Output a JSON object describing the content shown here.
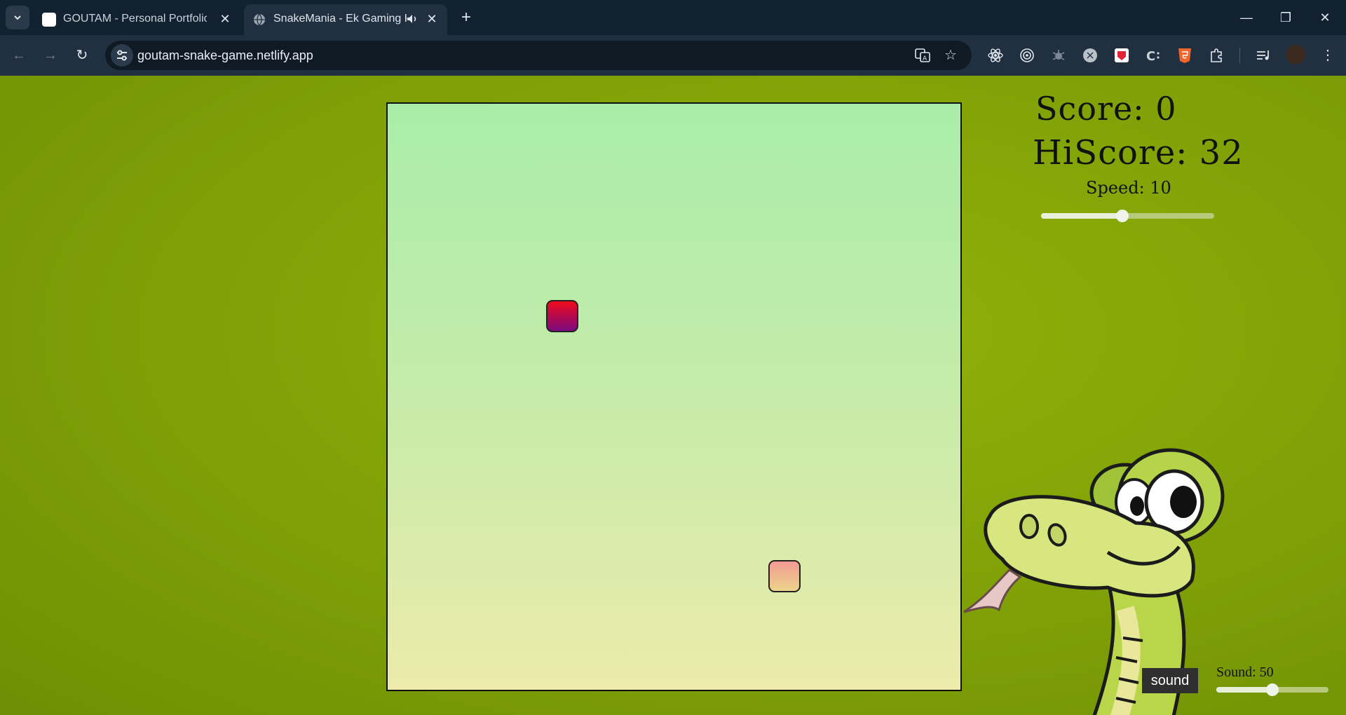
{
  "browser": {
    "tabs": [
      {
        "title": "GOUTAM - Personal Portfolio Te",
        "active": false
      },
      {
        "title": "SnakeMania - Ek Gaming Ka",
        "active": true
      }
    ],
    "url": "goutam-snake-game.netlify.app",
    "icons": {
      "tab_search": "chevron-down-icon",
      "new_tab": "+",
      "back": "←",
      "forward": "→",
      "reload": "↻",
      "minimize": "—",
      "maximize": "❐",
      "close": "✕",
      "translate": "translate-icon",
      "star": "☆",
      "menu": "⋮"
    }
  },
  "game": {
    "score_label": "Score: 0",
    "hiscore_label": "HiScore: 32",
    "speed_label": "Speed: 10",
    "speed_value_fraction": 0.47,
    "sound_button": "sound",
    "sound_label": "Sound: 50",
    "sound_value_fraction": 0.5,
    "colors": {
      "background": "#80a306",
      "food_top": "#ef0b1b",
      "food_bottom": "#7c0a80",
      "snake_top": "#f29a94",
      "snake_bottom": "#ecd48a"
    }
  }
}
